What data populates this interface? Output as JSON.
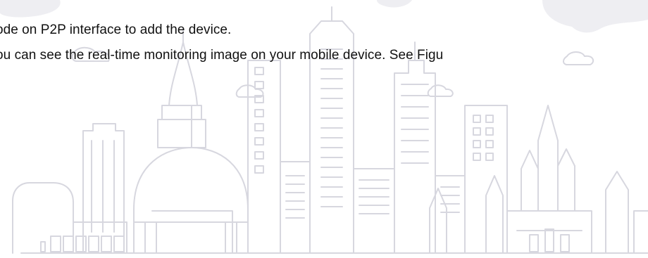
{
  "document": {
    "lines": [
      "ode on P2P interface to add the device.",
      "ou can see the real-time monitoring image on your mobile device. See Figu"
    ]
  },
  "watermark": {
    "icon": "city-skyline-watermark-icon",
    "color": "#d7d7df",
    "cloud_color": "#eeeef2"
  }
}
